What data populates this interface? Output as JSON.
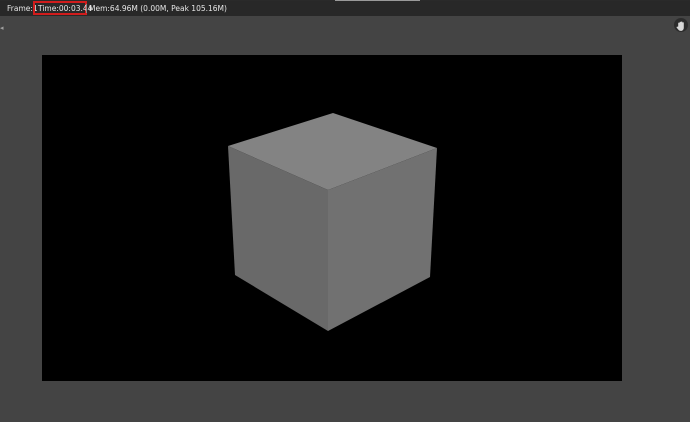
{
  "info_bar": {
    "frame": "Frame:1",
    "time": "Time:00:03.44",
    "mem": "Mem:64.96M (0.00M, Peak 105.16M)"
  },
  "icons": {
    "hand": "hand-pan-icon",
    "handle": "scroll-handle-icon"
  },
  "colors": {
    "highlight_box": "#d11c1c",
    "render_background": "#000000",
    "cube_top": "#838383",
    "cube_left": "#696969",
    "cube_right": "#717171"
  }
}
